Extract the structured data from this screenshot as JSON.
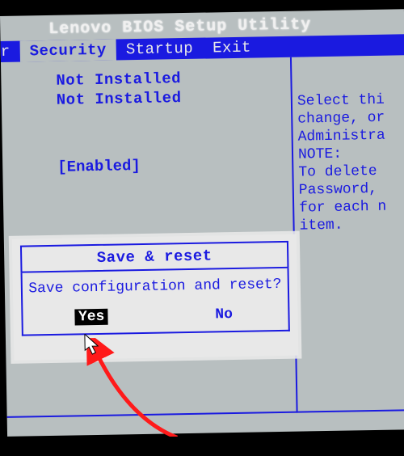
{
  "title": "Lenovo BIOS Setup Utility",
  "menu": {
    "partial_left": "r",
    "active": "Security",
    "item3": "Startup",
    "item4": "Exit"
  },
  "left_panel": {
    "status1": "Not Installed",
    "status2": "Not Installed",
    "enabled": "[Enabled]"
  },
  "right_panel": {
    "line1": "Select thi",
    "line2": "change, or",
    "line3": "Administra",
    "line4": "NOTE:",
    "line5": "To delete",
    "line6": "Password,",
    "line7": "for each n",
    "line8": "item."
  },
  "dialog": {
    "title": "Save & reset",
    "message": "Save configuration and reset?",
    "yes": "Yes",
    "no": "No"
  }
}
